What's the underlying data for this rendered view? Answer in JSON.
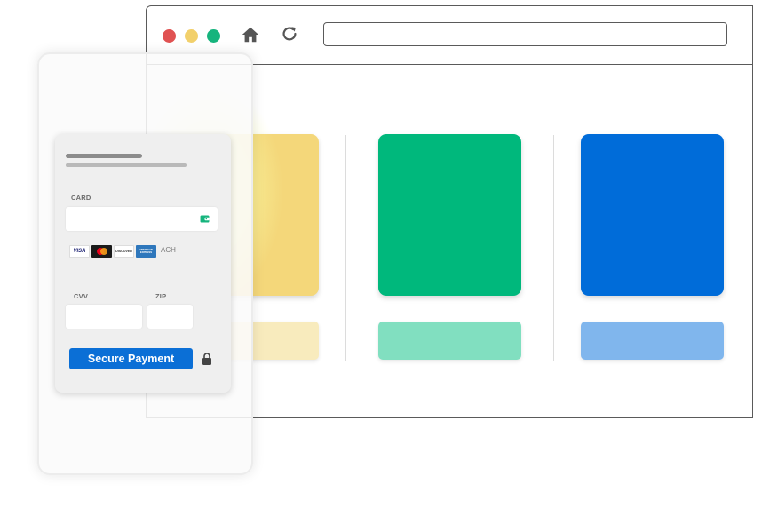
{
  "browser": {
    "url": "",
    "controls": [
      {
        "name": "close-dot",
        "color": "#e05252"
      },
      {
        "name": "minimize-dot",
        "color": "#f2d06b"
      },
      {
        "name": "maximize-dot",
        "color": "#16b47d"
      }
    ],
    "icons": {
      "home": "home-icon",
      "reload": "reload-icon"
    }
  },
  "page": {
    "tiles": [
      {
        "color": "#f4d77a",
        "light_color": "#f8ebbd"
      },
      {
        "color": "#00b87c",
        "light_color": "#81dfc0"
      },
      {
        "color": "#006cd9",
        "light_color": "#80b6ed"
      }
    ]
  },
  "payment": {
    "card_label": "CARD",
    "card_number": "",
    "wallet_icon": "wallet-icon",
    "brands": [
      "VISA",
      "Mastercard",
      "DISCOVER",
      "AMERICAN EXPRESS"
    ],
    "ach_label": "ACH",
    "cvv_label": "CVV",
    "cvv_value": "",
    "zip_label": "ZIP",
    "zip_value": "",
    "submit_label": "Secure Payment",
    "lock_icon": "lock-icon",
    "accent": "#0b6fd6"
  }
}
